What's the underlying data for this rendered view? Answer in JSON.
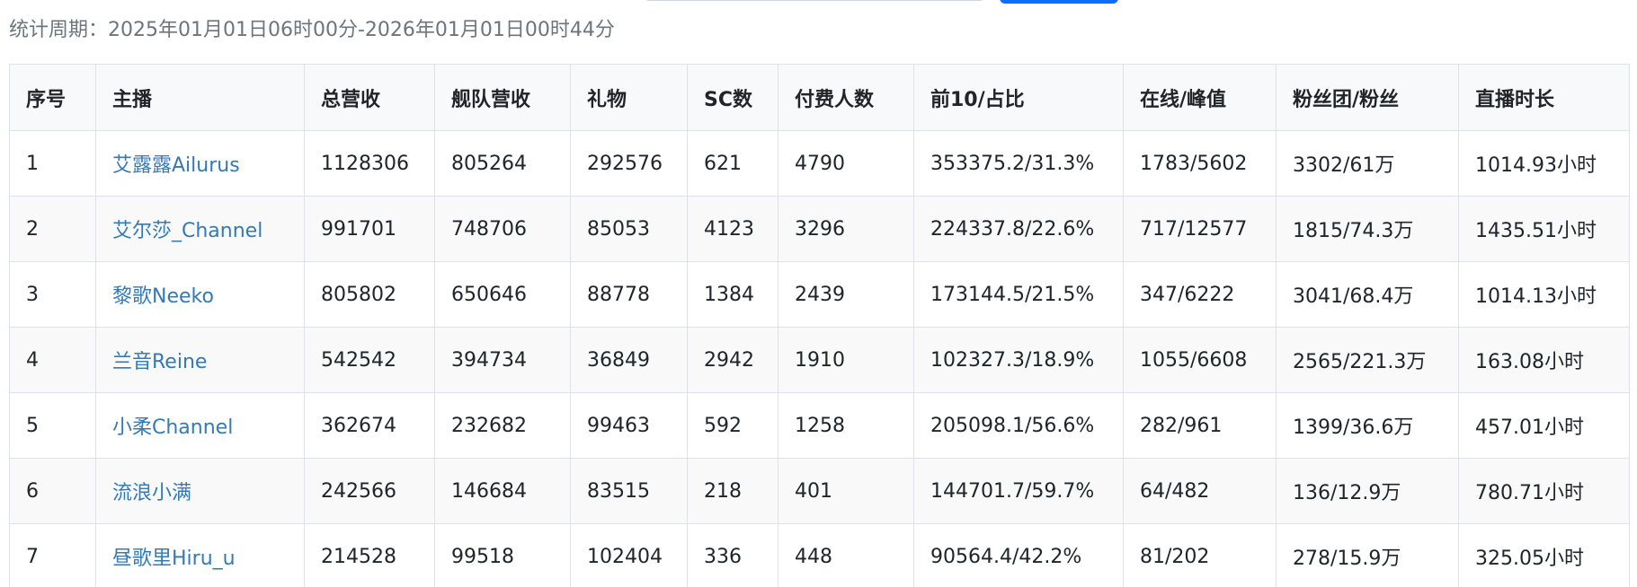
{
  "stats_period": "统计周期：2025年01月01日06时00分-2026年01月01日00时44分",
  "table": {
    "headers": [
      "序号",
      "主播",
      "总营收",
      "舰队营收",
      "礼物",
      "SC数",
      "付费人数",
      "前10/占比",
      "在线/峰值",
      "粉丝团/粉丝",
      "直播时长"
    ],
    "rows": [
      [
        "1",
        "艾露露Ailurus",
        "1128306",
        "805264",
        "292576",
        "621",
        "4790",
        "353375.2/31.3%",
        "1783/5602",
        "3302/61万",
        "1014.93小时"
      ],
      [
        "2",
        "艾尔莎_Channel",
        "991701",
        "748706",
        "85053",
        "4123",
        "3296",
        "224337.8/22.6%",
        "717/12577",
        "1815/74.3万",
        "1435.51小时"
      ],
      [
        "3",
        "黎歌Neeko",
        "805802",
        "650646",
        "88778",
        "1384",
        "2439",
        "173144.5/21.5%",
        "347/6222",
        "3041/68.4万",
        "1014.13小时"
      ],
      [
        "4",
        "兰音Reine",
        "542542",
        "394734",
        "36849",
        "2942",
        "1910",
        "102327.3/18.9%",
        "1055/6608",
        "2565/221.3万",
        "163.08小时"
      ],
      [
        "5",
        "小柔Channel",
        "362674",
        "232682",
        "99463",
        "592",
        "1258",
        "205098.1/56.6%",
        "282/961",
        "1399/36.6万",
        "457.01小时"
      ],
      [
        "6",
        "流浪小满",
        "242566",
        "146684",
        "83515",
        "218",
        "401",
        "144701.7/59.7%",
        "64/482",
        "136/12.9万",
        "780.71小时"
      ],
      [
        "7",
        "昼歌里Hiru_u",
        "214528",
        "99518",
        "102404",
        "336",
        "448",
        "90564.4/42.2%",
        "81/202",
        "278/15.9万",
        "325.05小时"
      ]
    ]
  }
}
